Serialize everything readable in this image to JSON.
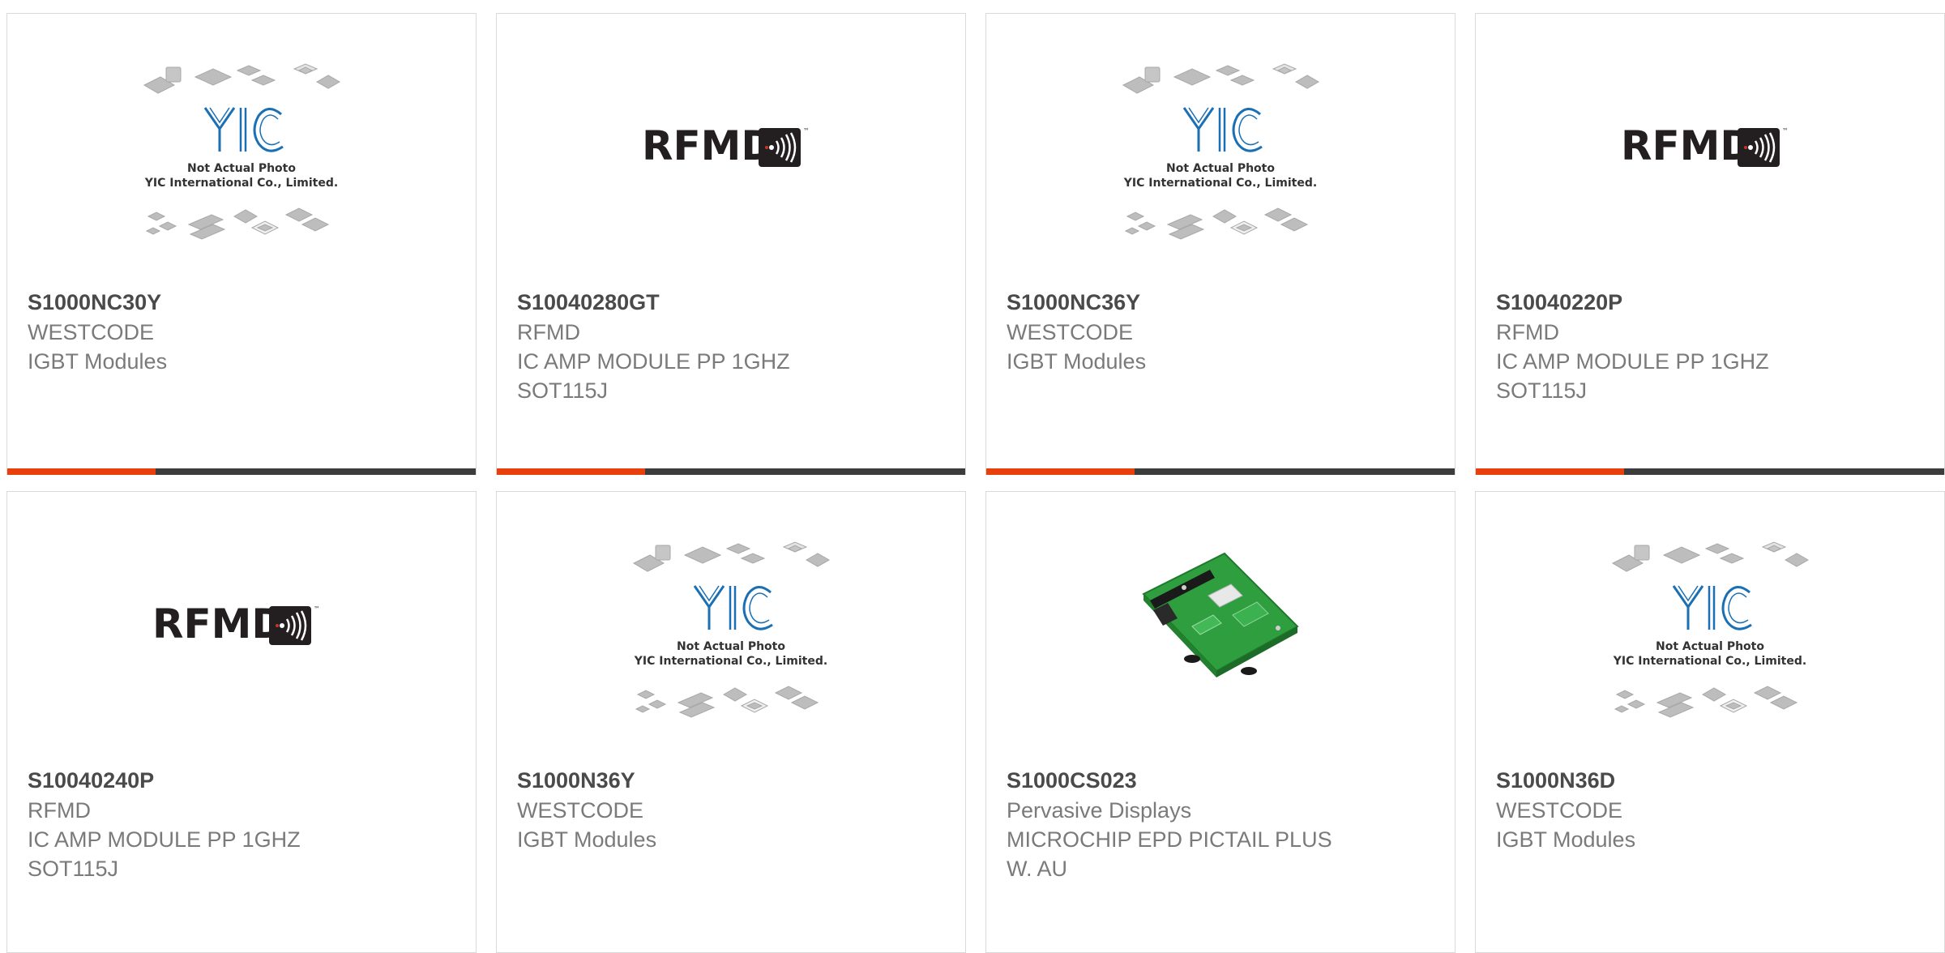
{
  "colors": {
    "accent": "#e8400c",
    "bar_dark": "#3c3c3c",
    "part_number": "#4a4a4a",
    "secondary_text": "#7a7a7a",
    "card_border": "#d9d9d9"
  },
  "yic_placeholder": {
    "logo_text": "YIC",
    "line1": "Not Actual Photo",
    "line2": "YIC International Co., Limited."
  },
  "rfmd_logo": {
    "text": "RFMD",
    "mark": "™"
  },
  "products": [
    {
      "image": "yic-placeholder",
      "part_number": "S1000NC30Y",
      "manufacturer": "WESTCODE",
      "description": [
        "IGBT Modules"
      ]
    },
    {
      "image": "rfmd-logo",
      "part_number": "S10040280GT",
      "manufacturer": "RFMD",
      "description": [
        "IC AMP MODULE PP 1GHZ",
        "SOT115J"
      ]
    },
    {
      "image": "yic-placeholder",
      "part_number": "S1000NC36Y",
      "manufacturer": "WESTCODE",
      "description": [
        "IGBT Modules"
      ]
    },
    {
      "image": "rfmd-logo",
      "part_number": "S10040220P",
      "manufacturer": "RFMD",
      "description": [
        "IC AMP MODULE PP 1GHZ",
        "SOT115J"
      ]
    },
    {
      "image": "rfmd-logo",
      "part_number": "S10040240P",
      "manufacturer": "RFMD",
      "description": [
        "IC AMP MODULE PP 1GHZ",
        "SOT115J"
      ]
    },
    {
      "image": "yic-placeholder",
      "part_number": "S1000N36Y",
      "manufacturer": "WESTCODE",
      "description": [
        "IGBT Modules"
      ]
    },
    {
      "image": "pcb-photo",
      "part_number": "S1000CS023",
      "manufacturer": "Pervasive Displays",
      "description": [
        "MICROCHIP EPD PICTAIL PLUS",
        "W. AU"
      ]
    },
    {
      "image": "yic-placeholder",
      "part_number": "S1000N36D",
      "manufacturer": "WESTCODE",
      "description": [
        "IGBT Modules"
      ]
    }
  ]
}
